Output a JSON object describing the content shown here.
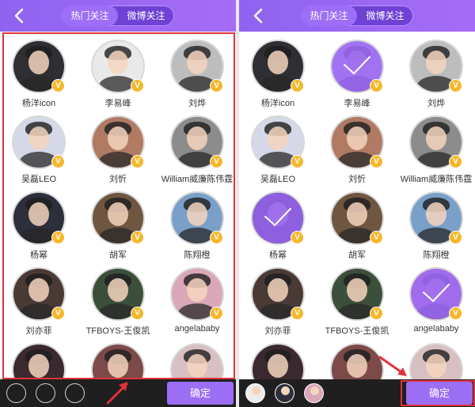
{
  "colors": {
    "topbar": "#9a68f4",
    "accent": "#9b6ef4",
    "badge": "#f6b72b",
    "selected_overlay": "#9966f3",
    "highlight_box": "#e0323a",
    "bottom_bar": "#1f1f1f"
  },
  "header": {
    "back_icon": "chevron-left-icon",
    "tabs": [
      {
        "label": "热门关注",
        "active": true
      },
      {
        "label": "微博关注",
        "active": false
      }
    ]
  },
  "celebrities": [
    {
      "name": "杨洋icon",
      "verified": true,
      "tint": "#2e2e33"
    },
    {
      "name": "李易峰",
      "verified": true,
      "tint": "#e9e9e9"
    },
    {
      "name": "刘烨",
      "verified": true,
      "tint": "#bdbdbd"
    },
    {
      "name": "吴磊LEO",
      "verified": true,
      "tint": "#d5d8e6"
    },
    {
      "name": "刘忻",
      "verified": true,
      "tint": "#b07a63"
    },
    {
      "name": "William威廉陈伟霆",
      "verified": true,
      "tint": "#8c8c8c"
    },
    {
      "name": "杨幂",
      "verified": true,
      "tint": "#2d2f3a"
    },
    {
      "name": "胡军",
      "verified": true,
      "tint": "#6e5640"
    },
    {
      "name": "陈翔橙",
      "verified": true,
      "tint": "#7aa0c9"
    },
    {
      "name": "刘亦菲",
      "verified": true,
      "tint": "#4a3a36"
    },
    {
      "name": "TFBOYS-王俊凯",
      "verified": true,
      "tint": "#3c4f3a"
    },
    {
      "name": "angelababy",
      "verified": true,
      "tint": "#d9a7b7"
    },
    {
      "name": "",
      "verified": false,
      "tint": "#3a2a2f"
    },
    {
      "name": "",
      "verified": false,
      "tint": "#7b4a49"
    },
    {
      "name": "",
      "verified": false,
      "tint": "#d8bfc2"
    }
  ],
  "left_screen": {
    "selected": []
  },
  "right_screen": {
    "selected": [
      1,
      6,
      11
    ]
  },
  "bottom": {
    "confirm_label": "确定"
  }
}
